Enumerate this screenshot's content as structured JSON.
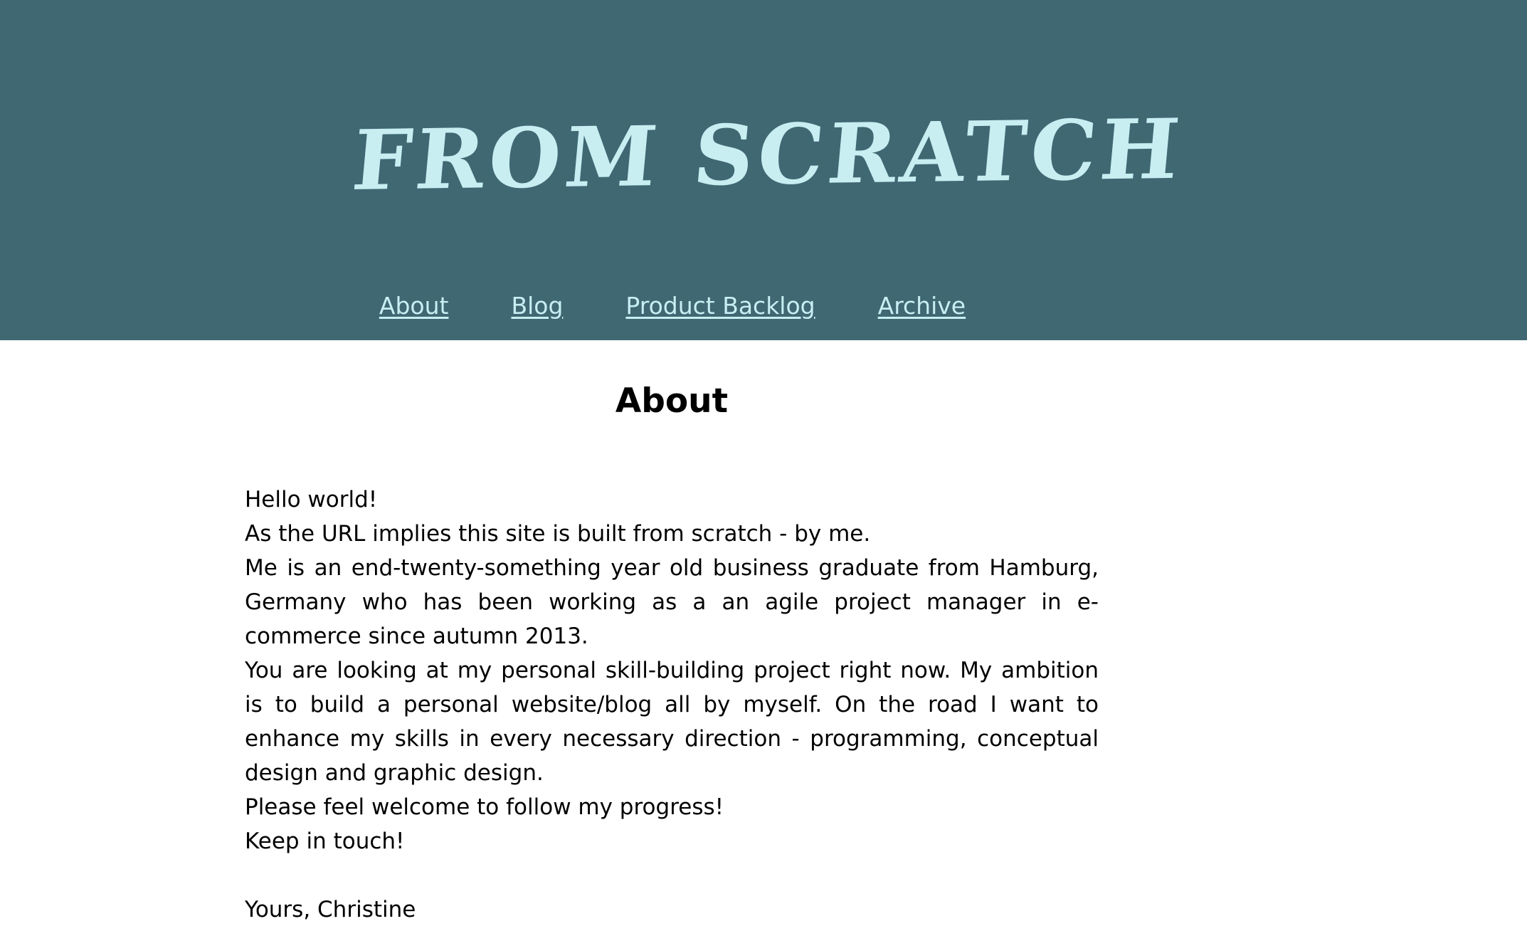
{
  "header": {
    "site_title": "From Scratch",
    "background_color": "#3f6873",
    "title_color": "#c8eef2"
  },
  "nav": {
    "items": [
      {
        "label": "About"
      },
      {
        "label": "Blog"
      },
      {
        "label": "Product Backlog"
      },
      {
        "label": "Archive"
      }
    ],
    "link_color": "#c8eef2"
  },
  "main": {
    "heading": "About",
    "paragraphs": [
      "Hello world!",
      "As the URL implies this site is built from scratch - by me.",
      "Me is an end-twenty-something year old business graduate from Hamburg, Germany who has been working as a an agile project manager in e-commerce since autumn 2013.",
      "You are looking at my personal skill-building project right now. My ambition is to build a personal website/blog all by myself. On the road I want to enhance my skills in every necessary direction - programming, conceptual design and graphic design.",
      "Please feel welcome to follow my progress!",
      "Keep in touch!"
    ],
    "signature": "Yours, Christine"
  }
}
